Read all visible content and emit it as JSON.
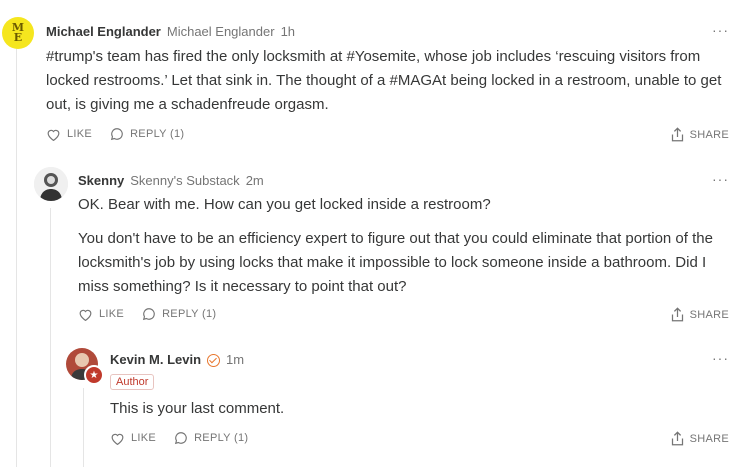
{
  "comments": [
    {
      "avatar_initials": "ME",
      "author": "Michael Englander",
      "publication": "Michael Englander",
      "time": "1h",
      "paragraphs": [
        "#trump's team has fired the only locksmith at #Yosemite, whose job includes ‘rescuing visitors from locked restrooms.’ Let that sink in. The thought of a #MAGAt being locked in a restroom, unable to get out, is giving me a schadenfreude orgasm."
      ],
      "like_label": "LIKE",
      "reply_label": "REPLY (1)",
      "share_label": "SHARE",
      "more_label": "···"
    },
    {
      "author": "Skenny",
      "publication": "Skenny's Substack",
      "time": "2m",
      "paragraphs": [
        "OK. Bear with me. How can you get locked inside a restroom?",
        "You don't have to be an efficiency expert to figure out that you could eliminate that portion of the locksmith's job by using locks that make it impossible to lock someone inside a bathroom. Did I miss something? Is it necessary to point that out?"
      ],
      "like_label": "LIKE",
      "reply_label": "REPLY (1)",
      "share_label": "SHARE",
      "more_label": "···"
    },
    {
      "author": "Kevin M. Levin",
      "time": "1m",
      "badge": "Author",
      "paragraphs": [
        "This is your last comment."
      ],
      "like_label": "LIKE",
      "reply_label": "REPLY (1)",
      "share_label": "SHARE",
      "more_label": "···"
    }
  ],
  "colors": {
    "text": "#363737",
    "muted": "#757575",
    "author_badge": "#c0392b",
    "verified": "#e8772e",
    "avatar_initials_bg": "#f5e61e"
  }
}
